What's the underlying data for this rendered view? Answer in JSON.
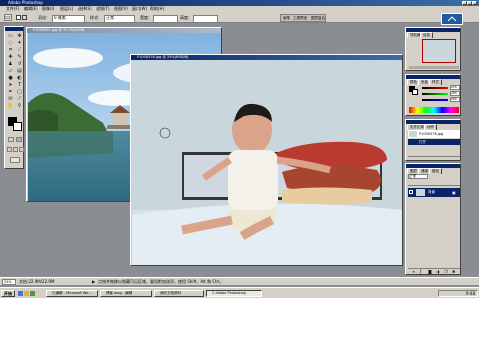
{
  "window": {
    "title": "Adobe Photoshop"
  },
  "menu": [
    "文件(F)",
    "编辑(E)",
    "图像(I)",
    "图层(L)",
    "选择(S)",
    "滤镜(T)",
    "视图(V)",
    "窗口(W)",
    "帮助(H)"
  ],
  "options_bar": {
    "feather_label": "羽化:",
    "feather_value": "0 像素",
    "style_label": "样式:",
    "style_value": "正常",
    "width_label": "宽度:",
    "height_label": "高度:",
    "palette_tabs": [
      "画笔",
      "工具预设",
      "图层复合"
    ]
  },
  "documents": [
    {
      "title": "P1000001.jpg @ 33.3%(RGB)",
      "active": false
    },
    {
      "title": "P1000576.jpg @ 25%(RGB/8)",
      "active": true
    }
  ],
  "panels": {
    "navigator": {
      "tabs": [
        "导航器",
        "信息"
      ]
    },
    "color": {
      "tabs": [
        "颜色",
        "色板",
        "样式"
      ],
      "values": [
        "255",
        "255",
        "255"
      ]
    },
    "history": {
      "tabs": [
        "历史记录",
        "动作"
      ],
      "items": [
        "P1000576.jpg",
        "打开"
      ]
    },
    "layers": {
      "tabs": [
        "图层",
        "通道",
        "路径"
      ],
      "mode": "正常",
      "layer_name": "背景"
    }
  },
  "status": {
    "zoom": "25%",
    "doc_size": "文档:22.9M/22.9M",
    "hint": "点按并拖移以隐藏可见区域，要用附加选项，使用 Shift、Alt 和 Ctrl。"
  },
  "taskbar": {
    "start": "开始",
    "tasks": [
      {
        "label": "已编辑 - Microsoft Wo...",
        "active": false
      },
      {
        "label": "博客 blog - 编辑",
        "active": false
      },
      {
        "label": "我的文档资料",
        "active": false
      },
      {
        "label": "2 Adobe Photoshop",
        "active": true
      }
    ],
    "time": "9:48"
  },
  "colors": {
    "title_active": "#0a246a",
    "chrome": "#d4d0c8",
    "workspace": "#8a8e93",
    "photo_wall": "#c9d7dd",
    "blanket": "#d8e2ee"
  },
  "icons": [
    "move-tool-icon",
    "marquee-tool-icon",
    "lasso-tool-icon",
    "crop-tool-icon",
    "brush-tool-icon",
    "eraser-tool-icon",
    "text-tool-icon",
    "hand-tool-icon",
    "zoom-tool-icon",
    "eyedropper-icon"
  ]
}
